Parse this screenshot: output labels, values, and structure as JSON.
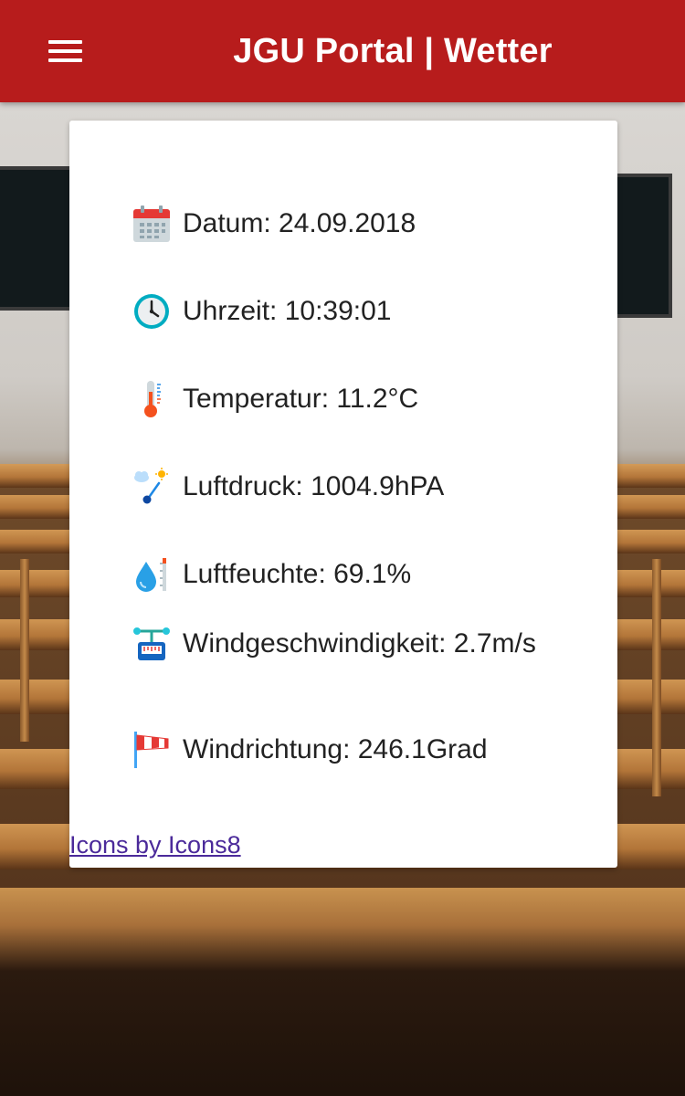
{
  "header": {
    "title": "JGU Portal | Wetter"
  },
  "weather": {
    "rows": [
      {
        "icon": "calendar-icon",
        "text": "Datum: 24.09.2018"
      },
      {
        "icon": "clock-icon",
        "text": "Uhrzeit: 10:39:01"
      },
      {
        "icon": "thermometer-icon",
        "text": "Temperatur: 11.2°C"
      },
      {
        "icon": "barometer-icon",
        "text": "Luftdruck: 1004.9hPA"
      },
      {
        "icon": "humidity-icon",
        "text": "Luftfeuchte: 69.1%"
      },
      {
        "icon": "anemometer-icon",
        "text": "Windgeschwindigkeit: 2.7m/s"
      },
      {
        "icon": "windsock-icon",
        "text": "Windrichtung: 246.1Grad"
      }
    ]
  },
  "footer": {
    "credit_link": "Icons by Icons8"
  },
  "colors": {
    "appbar": "#b71c1c",
    "card": "#ffffff",
    "link": "#4b2a9a"
  }
}
